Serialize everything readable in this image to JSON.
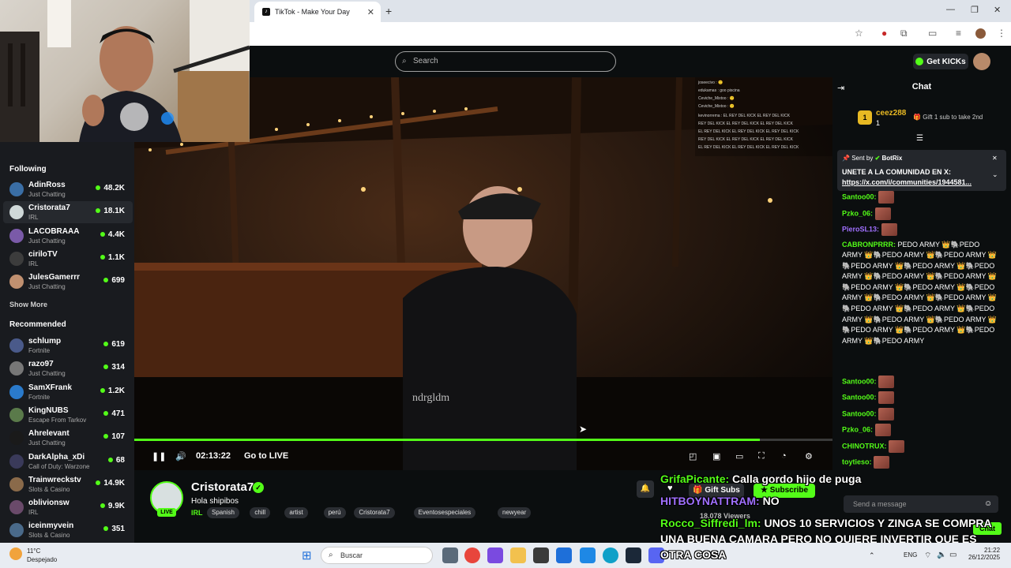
{
  "browser": {
    "tab_title": "TikTok - Make Your Day",
    "tab_icon": "tiktok-icon",
    "new_tab": "+"
  },
  "kick": {
    "search_placeholder": "Search",
    "get_kicks_label": "Get KICKs"
  },
  "sidebar": {
    "following_heading": "Following",
    "following": [
      {
        "name": "AdinRoss",
        "category": "Just Chatting",
        "viewers": "48.2K",
        "color": "#3a6ea5"
      },
      {
        "name": "Cristorata7",
        "category": "IRL",
        "viewers": "18.1K",
        "color": "#cfd8d8",
        "active": true
      },
      {
        "name": "LACOBRAAA",
        "category": "Just Chatting",
        "viewers": "4.4K",
        "color": "#7a5aa8"
      },
      {
        "name": "ciriloTV",
        "category": "IRL",
        "viewers": "1.1K",
        "color": "#3c3c3c"
      },
      {
        "name": "JulesGamerrr",
        "category": "Just Chatting",
        "viewers": "699",
        "color": "#c09070"
      }
    ],
    "show_more": "Show More",
    "recommended_heading": "Recommended",
    "recommended": [
      {
        "name": "schlump",
        "category": "Fortnite",
        "viewers": "619",
        "color": "#4a5a8a"
      },
      {
        "name": "razo97",
        "category": "Just Chatting",
        "viewers": "314",
        "color": "#777"
      },
      {
        "name": "SamXFrank",
        "category": "Fortnite",
        "viewers": "1.2K",
        "color": "#2a7acb"
      },
      {
        "name": "KingNUBS",
        "category": "Escape From Tarkov",
        "viewers": "471",
        "color": "#5a7a4a"
      },
      {
        "name": "Ahrelevant",
        "category": "Just Chatting",
        "viewers": "107",
        "color": "#1a1a1a"
      },
      {
        "name": "DarkAlpha_xDi",
        "category": "Call of Duty: Warzone",
        "viewers": "68",
        "color": "#3a3a5a"
      },
      {
        "name": "Trainwreckstv",
        "category": "Slots & Casino",
        "viewers": "14.9K",
        "color": "#8a6a4a"
      },
      {
        "name": "oblivionsw",
        "category": "IRL",
        "viewers": "9.9K",
        "color": "#6a4a6a"
      },
      {
        "name": "iceinmyvein",
        "category": "Slots & Casino",
        "viewers": "351",
        "color": "#4a6a8a"
      }
    ]
  },
  "player": {
    "time": "02:13:22",
    "go_live": "Go to LIVE",
    "progress": 0.896
  },
  "channel": {
    "name": "Cristorata7",
    "live_badge": "LIVE",
    "title": "Hola shipibos",
    "category": "IRL",
    "tags": [
      "Spanish",
      "chill",
      "artist",
      "perú",
      "Cristorata7",
      "Eventosespeciales",
      "newyear"
    ],
    "gift_subs_label": "Gift Subs",
    "subscribe_label": "Subscribe",
    "viewers": "18,078 Viewers"
  },
  "chat": {
    "header": "Chat",
    "top_gifter": {
      "rank": "1",
      "name": "ceez288",
      "count": "1"
    },
    "gift_prompt": "Gift 1 sub to take 2nd",
    "pinned": {
      "sent_by": "Sent by",
      "bot": "BotRix",
      "title": "UNETE A LA COMUNIDAD EN X:",
      "link": "https://x.com/i/communities/1944581..."
    },
    "messages": [
      {
        "user": "Santoo00:"
      },
      {
        "user": "Pzko_06:"
      },
      {
        "user": "PieroSL13:",
        "alt": true
      },
      {
        "user": "CABRONPRRR:",
        "text": "PEDO ARMY 👑🐘PEDO ARMY 👑🐘PEDO ARMY 👑🐘PEDO ARMY 👑🐘PEDO ARMY 👑🐘PEDO ARMY 👑🐘PEDO ARMY 👑🐘PEDO ARMY 👑🐘PEDO ARMY 👑🐘PEDO ARMY 👑🐘PEDO ARMY 👑🐘PEDO ARMY 👑🐘PEDO ARMY 👑🐘PEDO ARMY 👑🐘PEDO ARMY 👑🐘PEDO ARMY 👑🐘PEDO ARMY 👑🐘PEDO ARMY 👑🐘PEDO ARMY 👑🐘PEDO ARMY 👑🐘PEDO ARMY 👑🐘PEDO ARMY 👑🐘PEDO ARMY"
      },
      {
        "user": "Santoo00:"
      },
      {
        "user": "Santoo00:"
      },
      {
        "user": "Santoo00:"
      },
      {
        "user": "Pzko_06:"
      },
      {
        "user": "CHINOTRUX:"
      },
      {
        "user": "toytieso:"
      }
    ],
    "input_placeholder": "Send a message",
    "chat_button": "Chat"
  },
  "overlay": {
    "line1_user": "GrifaPicante:",
    "line1_text": "Calla gordo hijo de puga",
    "line2_user": "HITBOYNATTRAM:",
    "line2_text": "NO",
    "line3_user": "Rocco_Siffredi_lm:",
    "line3_text": "UNOS 10 SERVICIOS Y ZINGA SE COMPRA",
    "line4_text": "UNA BUENA CAMARA PERO NO QUIERE INVERTIR QUE ES",
    "line5_text": "OTRA COSA"
  },
  "taskbar": {
    "temp": "11°C",
    "weather": "Despejado",
    "search_placeholder": "Buscar",
    "lang": "ENG",
    "time": "21:22",
    "date": "26/12/2025"
  },
  "colors": {
    "accent": "#53fc18",
    "background": "#0b0e0f",
    "sidebar": "#191b1f"
  }
}
